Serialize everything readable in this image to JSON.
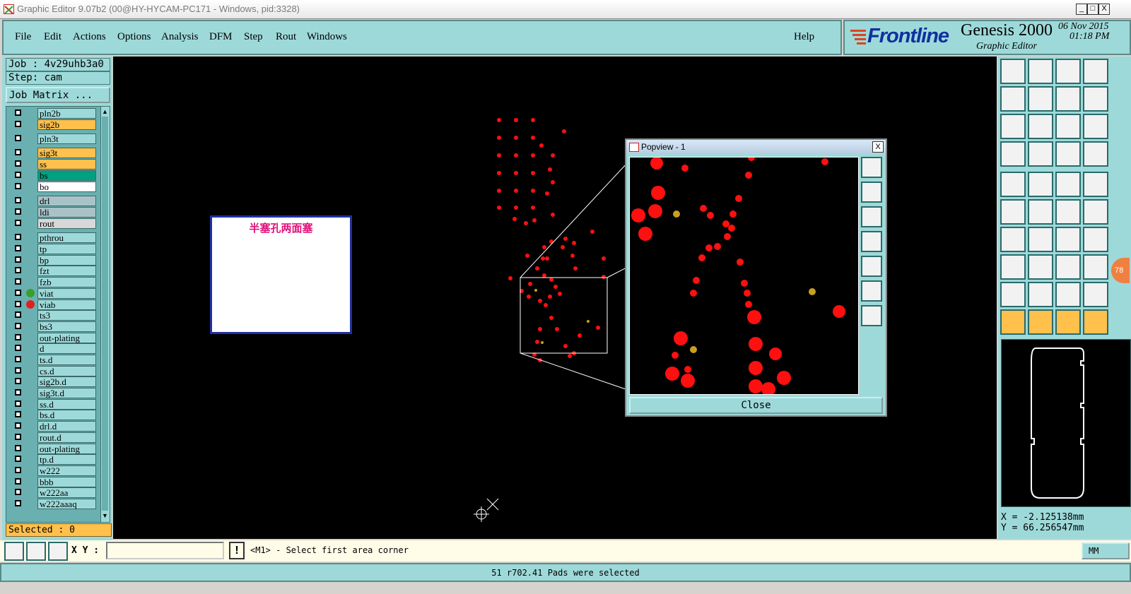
{
  "window": {
    "title": "Graphic Editor 9.07b2 (00@HY-HYCAM-PC171 - Windows, pid:3328)",
    "btn_min": "_",
    "btn_max": "□",
    "btn_close": "X"
  },
  "menu": {
    "items": [
      "File",
      "Edit",
      "Actions",
      "Options",
      "Analysis",
      "DFM",
      "Step",
      "Rout",
      "Windows"
    ],
    "help": "Help"
  },
  "brand": {
    "logo": "Frontline",
    "product": "Genesis 2000",
    "subtitle": "Graphic Editor",
    "date": "06 Nov 2015",
    "time": "01:18 PM"
  },
  "job": {
    "job_label": "Job : 4v29uhb3a0",
    "step_label": "Step: cam",
    "matrix_button": "Job Matrix ..."
  },
  "layers": [
    {
      "name": "pln2b",
      "color": "#9ed9d9"
    },
    {
      "name": "sig2b",
      "color": "#ffc04c"
    },
    {
      "name": "pln3t",
      "color": "#9ed9d9"
    },
    {
      "name": "sig3t",
      "color": "#ffc04c"
    },
    {
      "name": "ss",
      "color": "#ffc04c"
    },
    {
      "name": "bs",
      "color": "#00a080"
    },
    {
      "name": "bo",
      "color": "#ffffff"
    },
    {
      "name": "drl",
      "color": "#a9c2c8"
    },
    {
      "name": "ldi",
      "color": "#a9c2c8"
    },
    {
      "name": "rout",
      "color": "#d8d8d8"
    },
    {
      "name": "pthrou",
      "color": "#9ed9d9"
    },
    {
      "name": "tp",
      "color": "#9ed9d9"
    },
    {
      "name": "bp",
      "color": "#9ed9d9"
    },
    {
      "name": "fzt",
      "color": "#9ed9d9"
    },
    {
      "name": "fzb",
      "color": "#9ed9d9"
    },
    {
      "name": "viat",
      "color": "#9ed9d9",
      "marker": "#3aa02a"
    },
    {
      "name": "viab",
      "color": "#9ed9d9",
      "marker": "#e02020"
    },
    {
      "name": "ts3",
      "color": "#9ed9d9"
    },
    {
      "name": "bs3",
      "color": "#9ed9d9"
    },
    {
      "name": "out-plating",
      "color": "#9ed9d9"
    },
    {
      "name": "d",
      "color": "#9ed9d9"
    },
    {
      "name": "ts.d",
      "color": "#9ed9d9"
    },
    {
      "name": "cs.d",
      "color": "#9ed9d9"
    },
    {
      "name": "sig2b.d",
      "color": "#9ed9d9"
    },
    {
      "name": "sig3t.d",
      "color": "#9ed9d9"
    },
    {
      "name": "ss.d",
      "color": "#9ed9d9"
    },
    {
      "name": "bs.d",
      "color": "#9ed9d9"
    },
    {
      "name": "drl.d",
      "color": "#9ed9d9"
    },
    {
      "name": "rout.d",
      "color": "#9ed9d9"
    },
    {
      "name": "out-plating",
      "color": "#9ed9d9"
    },
    {
      "name": "tp.d",
      "color": "#9ed9d9"
    },
    {
      "name": "w222",
      "color": "#9ed9d9"
    },
    {
      "name": "bbb",
      "color": "#9ed9d9"
    },
    {
      "name": "w222aa",
      "color": "#9ed9d9"
    },
    {
      "name": "w222aaaq",
      "color": "#9ed9d9"
    }
  ],
  "selected": "Selected : 0",
  "note": {
    "text": "半塞孔两面塞",
    "color": "#e0107a"
  },
  "popview": {
    "title": "Popview - 1",
    "close_button": "Close",
    "close_x": "X"
  },
  "coords": {
    "x": "X = -2.125138mm",
    "y": "Y = 66.256547mm"
  },
  "bubble": "78",
  "command": {
    "xy_label": "X Y :",
    "xy_value": "",
    "alert": "!",
    "prompt": "<M1> - Select first area corner",
    "units": "MM"
  },
  "status": "51 r702.41 Pads were selected",
  "colors": {
    "panel": "#9ed9d9",
    "pad_red": "#ff1010",
    "pad_gold": "#c8a020",
    "canvas": "#000000"
  }
}
